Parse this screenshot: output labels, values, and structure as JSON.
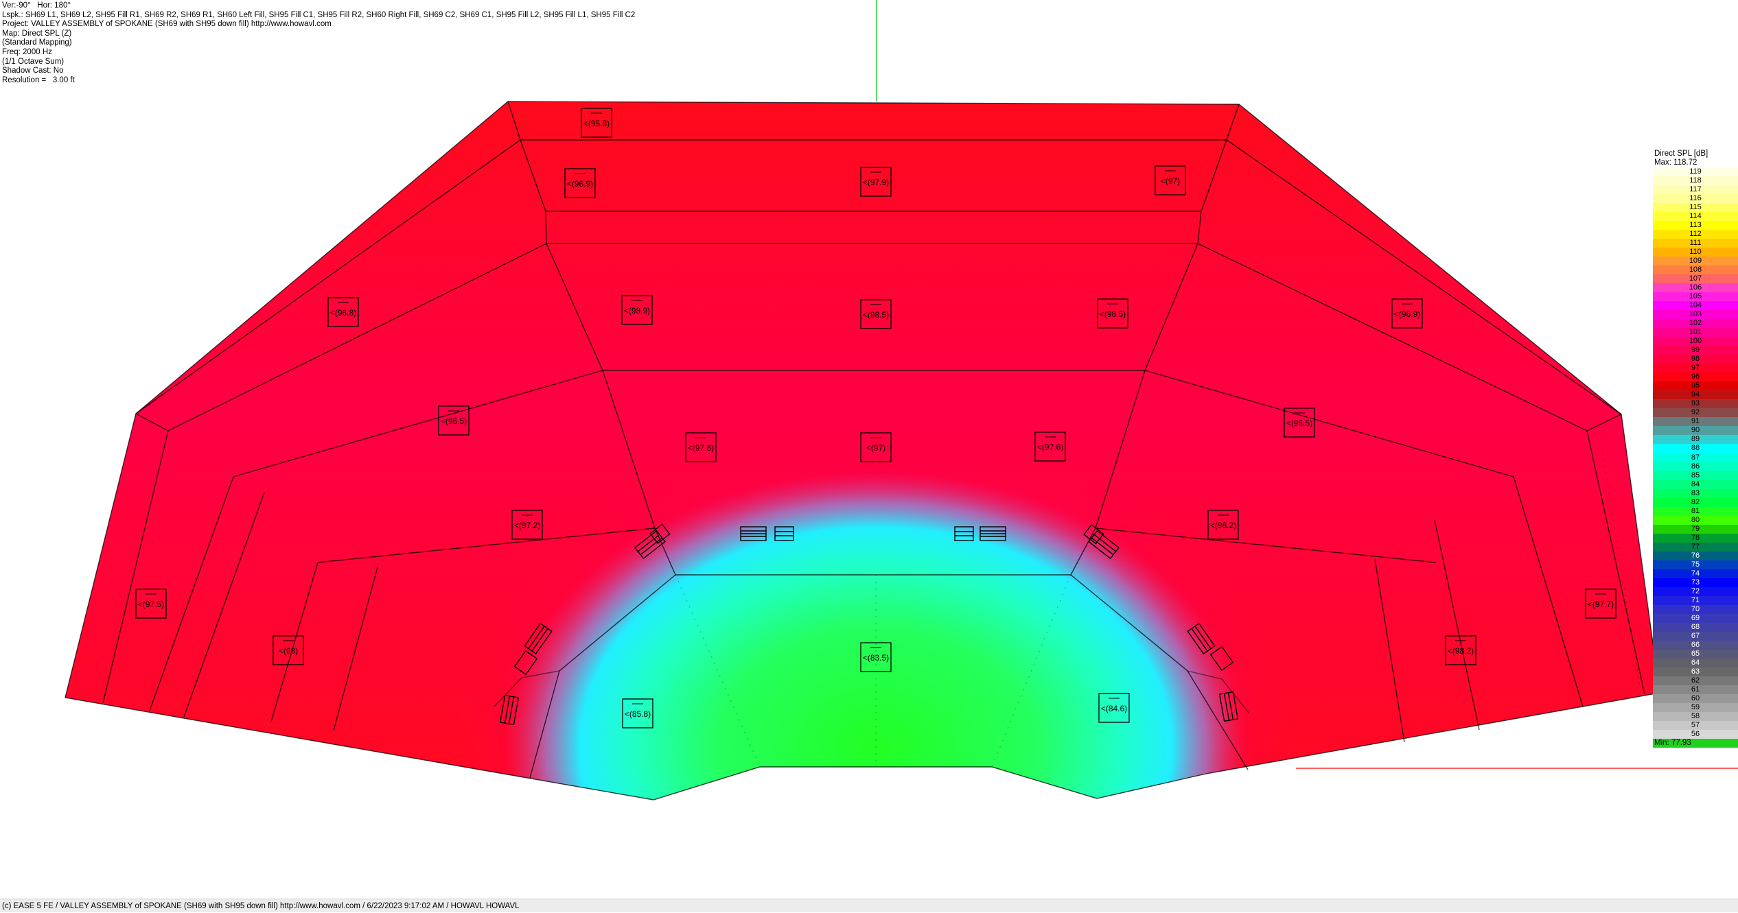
{
  "info_lines": [
    "Ver:-90°   Hor: 180°",
    "Lspk.: SH69 L1, SH69 L2, SH95 Fill R1, SH69 R2, SH69 R1, SH60 Left Fill, SH95 Fill C1, SH95 Fill R2, SH60 Right Fill, SH69 C2, SH69 C1, SH95 Fill L2, SH95 Fill L1, SH95 Fill C2",
    "Project: VALLEY ASSEMBLY of SPOKANE (SH69 with SH95 down fill) http://www.howavl.com",
    "Map: Direct SPL (Z)",
    "(Standard Mapping)",
    "Freq: 2000 Hz",
    "(1/1 Octave Sum)",
    "Shadow Cast: No",
    "Resolution =   3.00 ft"
  ],
  "spl_labels": [
    {
      "text": "(95.8)"
    },
    {
      "text": "(96.9)"
    },
    {
      "text": "(97.9)"
    },
    {
      "text": "(97)"
    },
    {
      "text": "(96.8)"
    },
    {
      "text": "(98.9)"
    },
    {
      "text": "(98.5)"
    },
    {
      "text": "(98.5)"
    },
    {
      "text": "(96.9)"
    },
    {
      "text": "(96.5)"
    },
    {
      "text": "(97.8)"
    },
    {
      "text": "(97)"
    },
    {
      "text": "(97.6)"
    },
    {
      "text": "(96.5)"
    },
    {
      "text": "(97.2)"
    },
    {
      "text": "(96.2)"
    },
    {
      "text": "(97.5)"
    },
    {
      "text": "(98)"
    },
    {
      "text": "(83.5)"
    },
    {
      "text": "(98.2)"
    },
    {
      "text": "(97.7)"
    },
    {
      "text": "(85.8)"
    },
    {
      "text": "(84.6)"
    }
  ],
  "legend": {
    "title": "Direct SPL [dB]",
    "max_label": "Max:  118.72",
    "min_label": "Min:  77.93",
    "scale": [
      {
        "v": "119",
        "c": "#ffffe6"
      },
      {
        "v": "118",
        "c": "#ffffcc"
      },
      {
        "v": "117",
        "c": "#ffffb3"
      },
      {
        "v": "116",
        "c": "#ffff99"
      },
      {
        "v": "115",
        "c": "#ffff66"
      },
      {
        "v": "114",
        "c": "#ffff33"
      },
      {
        "v": "113",
        "c": "#ffff00"
      },
      {
        "v": "112",
        "c": "#ffe600"
      },
      {
        "v": "111",
        "c": "#ffcc00"
      },
      {
        "v": "110",
        "c": "#ffb300"
      },
      {
        "v": "109",
        "c": "#ff9933"
      },
      {
        "v": "108",
        "c": "#ff8040"
      },
      {
        "v": "107",
        "c": "#ff6666"
      },
      {
        "v": "106",
        "c": "#ff40c0"
      },
      {
        "v": "105",
        "c": "#ff20e0"
      },
      {
        "v": "104",
        "c": "#ff00ff"
      },
      {
        "v": "103",
        "c": "#ff00d0"
      },
      {
        "v": "102",
        "c": "#ff00b0"
      },
      {
        "v": "101",
        "c": "#ff0090"
      },
      {
        "v": "100",
        "c": "#ff0070"
      },
      {
        "v": "99",
        "c": "#ff0058"
      },
      {
        "v": "98",
        "c": "#ff0040"
      },
      {
        "v": "97",
        "c": "#ff0028"
      },
      {
        "v": "96",
        "c": "#ff0010"
      },
      {
        "v": "95",
        "c": "#e00000"
      },
      {
        "v": "94",
        "c": "#c01010"
      },
      {
        "v": "93",
        "c": "#a03030"
      },
      {
        "v": "92",
        "c": "#8a4a4a"
      },
      {
        "v": "91",
        "c": "#6a7a7a"
      },
      {
        "v": "90",
        "c": "#50a0a0"
      },
      {
        "v": "89",
        "c": "#30d0d0"
      },
      {
        "v": "88",
        "c": "#00ffff"
      },
      {
        "v": "87",
        "c": "#00ffe0"
      },
      {
        "v": "86",
        "c": "#00ffc0"
      },
      {
        "v": "85",
        "c": "#00ffa0"
      },
      {
        "v": "84",
        "c": "#00ff80"
      },
      {
        "v": "83",
        "c": "#00ff60"
      },
      {
        "v": "82",
        "c": "#00ff40"
      },
      {
        "v": "81",
        "c": "#20ff20"
      },
      {
        "v": "80",
        "c": "#40ff00"
      },
      {
        "v": "79",
        "c": "#20d000"
      },
      {
        "v": "78",
        "c": "#00a030"
      },
      {
        "v": "77",
        "c": "#008050"
      },
      {
        "v": "76",
        "c": "#006080"
      },
      {
        "v": "75",
        "c": "#0040c0"
      },
      {
        "v": "74",
        "c": "#0020e0"
      },
      {
        "v": "73",
        "c": "#0000ff"
      },
      {
        "v": "72",
        "c": "#1010f0"
      },
      {
        "v": "71",
        "c": "#2020e0"
      },
      {
        "v": "70",
        "c": "#3030c8"
      },
      {
        "v": "69",
        "c": "#3838b8"
      },
      {
        "v": "68",
        "c": "#4040a8"
      },
      {
        "v": "67",
        "c": "#484898"
      },
      {
        "v": "66",
        "c": "#505088"
      },
      {
        "v": "65",
        "c": "#585878"
      },
      {
        "v": "64",
        "c": "#606068"
      },
      {
        "v": "63",
        "c": "#686868"
      },
      {
        "v": "62",
        "c": "#787878"
      },
      {
        "v": "61",
        "c": "#888888"
      },
      {
        "v": "60",
        "c": "#989898"
      },
      {
        "v": "59",
        "c": "#a8a8a8"
      },
      {
        "v": "58",
        "c": "#b8b8b8"
      },
      {
        "v": "57",
        "c": "#c8c8c8"
      },
      {
        "v": "56",
        "c": "#d8d8d8"
      }
    ]
  },
  "status_text": "(c) EASE 5 FE   / VALLEY ASSEMBLY of SPOKANE (SH69 with SH95 down fill) http://www.howavl.com   / 6/22/2023 9:17:02 AM / HOWAVL HOWAVL"
}
